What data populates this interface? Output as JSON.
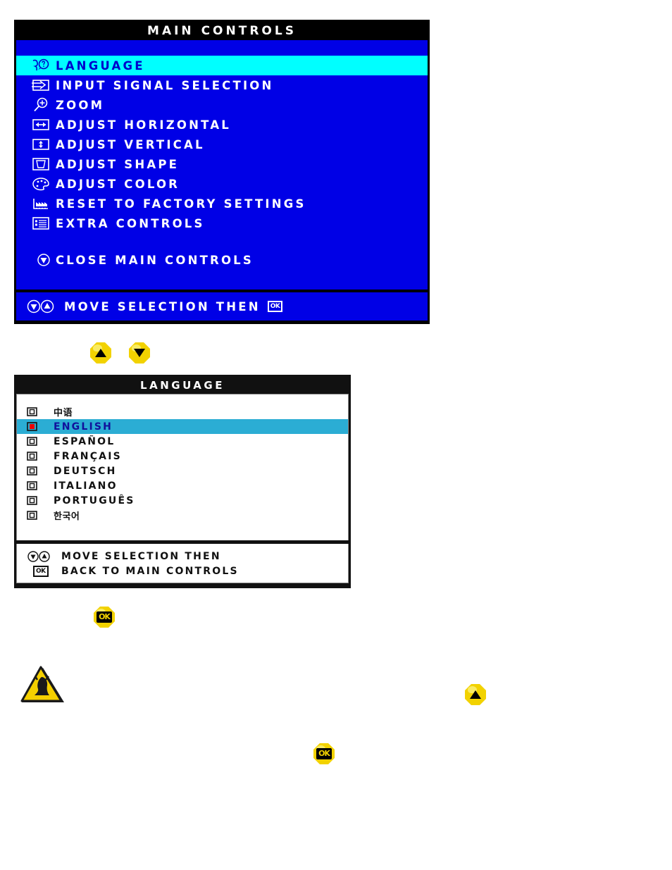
{
  "main_controls": {
    "title": "MAIN CONTROLS",
    "items": [
      {
        "label": "LANGUAGE",
        "icon": "language-head-question-icon",
        "selected": true
      },
      {
        "label": "INPUT SIGNAL SELECTION",
        "icon": "input-signal-arrow-icon",
        "selected": false
      },
      {
        "label": "ZOOM",
        "icon": "magnifier-plus-icon",
        "selected": false
      },
      {
        "label": "ADJUST HORIZONTAL",
        "icon": "horizontal-arrows-icon",
        "selected": false
      },
      {
        "label": "ADJUST VERTICAL",
        "icon": "vertical-arrows-icon",
        "selected": false
      },
      {
        "label": "ADJUST SHAPE",
        "icon": "shape-frame-icon",
        "selected": false
      },
      {
        "label": "ADJUST COLOR",
        "icon": "color-palette-icon",
        "selected": false
      },
      {
        "label": "RESET TO FACTORY SETTINGS",
        "icon": "factory-icon",
        "selected": false
      },
      {
        "label": "EXTRA CONTROLS",
        "icon": "list-lines-icon",
        "selected": false
      }
    ],
    "close_item": {
      "label": "CLOSE MAIN CONTROLS",
      "icon": "down-arrow-circle-icon"
    },
    "footer": {
      "text": "MOVE SELECTION THEN",
      "ok_label": "OK"
    }
  },
  "language_panel": {
    "title": "LANGUAGE",
    "options": [
      {
        "label": "中语",
        "script": "cjk",
        "selected": false
      },
      {
        "label": "ENGLISH",
        "script": "latin",
        "selected": true
      },
      {
        "label": "ESPAÑOL",
        "script": "latin",
        "selected": false
      },
      {
        "label": "FRANÇAIS",
        "script": "latin",
        "selected": false
      },
      {
        "label": "DEUTSCH",
        "script": "latin",
        "selected": false
      },
      {
        "label": "ITALIANO",
        "script": "latin",
        "selected": false
      },
      {
        "label": "PORTUGUÊS",
        "script": "latin",
        "selected": false
      },
      {
        "label": "한국어",
        "script": "cjk",
        "selected": false
      }
    ],
    "footer_line1": "MOVE SELECTION THEN",
    "footer_line2": "BACK TO MAIN CONTROLS",
    "ok_label": "OK"
  },
  "buttons": {
    "up_label": "up-arrow-button",
    "down_label": "down-arrow-button",
    "ok_label": "OK"
  },
  "colors": {
    "osd_blue": "#0000e6",
    "osd_highlight_cyan": "#00ffff",
    "lang_highlight": "#2badd4",
    "button_yellow": "#f2d200",
    "selected_red": "#ee0000",
    "black": "#000000",
    "white": "#ffffff"
  }
}
